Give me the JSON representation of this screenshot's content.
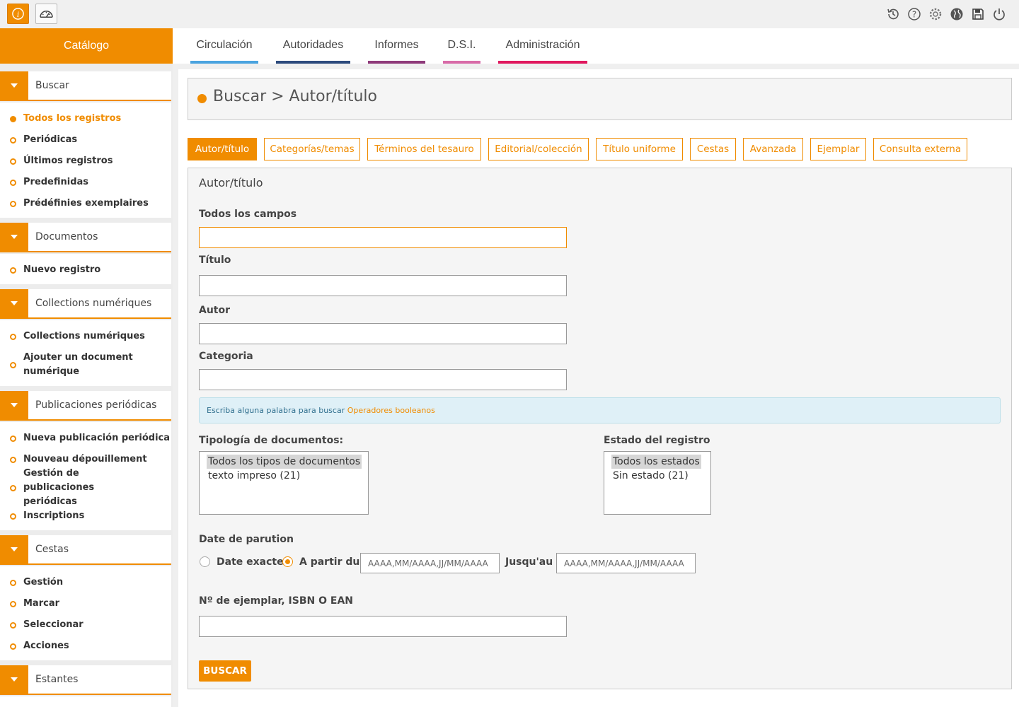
{
  "colors": {
    "accent": "#f08c00",
    "circulacion": "#4aa3df",
    "autoridades": "#2c4a7c",
    "informes": "#8e3a7a",
    "dsi": "#d86ba8",
    "administracion": "#e0185e"
  },
  "topbar": {
    "left_icons": [
      "info-icon",
      "dashboard-icon"
    ],
    "right_icons": [
      "history-icon",
      "help-icon",
      "settings-icon",
      "globe-icon",
      "save-icon",
      "power-icon"
    ]
  },
  "catalog": {
    "label": "Catálogo"
  },
  "main_tabs": [
    {
      "label": "Circulación"
    },
    {
      "label": "Autoridades"
    },
    {
      "label": "Informes"
    },
    {
      "label": "D.S.I."
    },
    {
      "label": "Administración"
    }
  ],
  "sidebar": {
    "sections": [
      {
        "label": "Buscar",
        "items": [
          "Todos los registros",
          "Periódicas",
          "Últimos registros",
          "Predefinidas",
          "Prédéfinies exemplaires"
        ]
      },
      {
        "label": "Documentos",
        "items": [
          "Nuevo registro"
        ]
      },
      {
        "label": "Collections numériques",
        "items": [
          "Collections numériques",
          "Ajouter un document numérique"
        ]
      },
      {
        "label": "Publicaciones periódicas",
        "items": [
          "Nueva publicación periódica",
          "Nouveau dépouillement",
          "Gestión de publicaciones periódicas",
          "Inscriptions"
        ]
      },
      {
        "label": "Cestas",
        "items": [
          "Gestión",
          "Marcar",
          "Seleccionar",
          "Acciones"
        ]
      },
      {
        "label": "Estantes",
        "items": []
      }
    ]
  },
  "breadcrumb": {
    "title": "Buscar > Autor/título"
  },
  "search_tabs": [
    "Autor/título",
    "Categorías/temas",
    "Términos del tesauro",
    "Editorial/colección",
    "Título uniforme",
    "Cestas",
    "Avanzada",
    "Ejemplar",
    "Consulta externa"
  ],
  "form": {
    "title": "Autor/título",
    "fields": {
      "all": "Todos los campos",
      "title": "Título",
      "author": "Autor",
      "category": "Categoria"
    },
    "info_text": "Escriba alguna palabra para buscar",
    "info_link": "Operadores booleanos",
    "doc_type": {
      "label": "Tipología de documentos:",
      "options": [
        "Todos los tipos de documentos",
        "texto impreso (21)"
      ]
    },
    "status": {
      "label": "Estado del registro",
      "options": [
        "Todos los estados",
        "Sin estado (21)"
      ]
    },
    "date": {
      "label": "Date de parution",
      "exact": "Date exacte",
      "from": "A partir du",
      "until": "Jusqu'au",
      "placeholder": "AAAA,MM/AAAA,JJ/MM/AAAA"
    },
    "isbn_label": "Nº de ejemplar, ISBN O EAN",
    "submit": "BUSCAR"
  }
}
